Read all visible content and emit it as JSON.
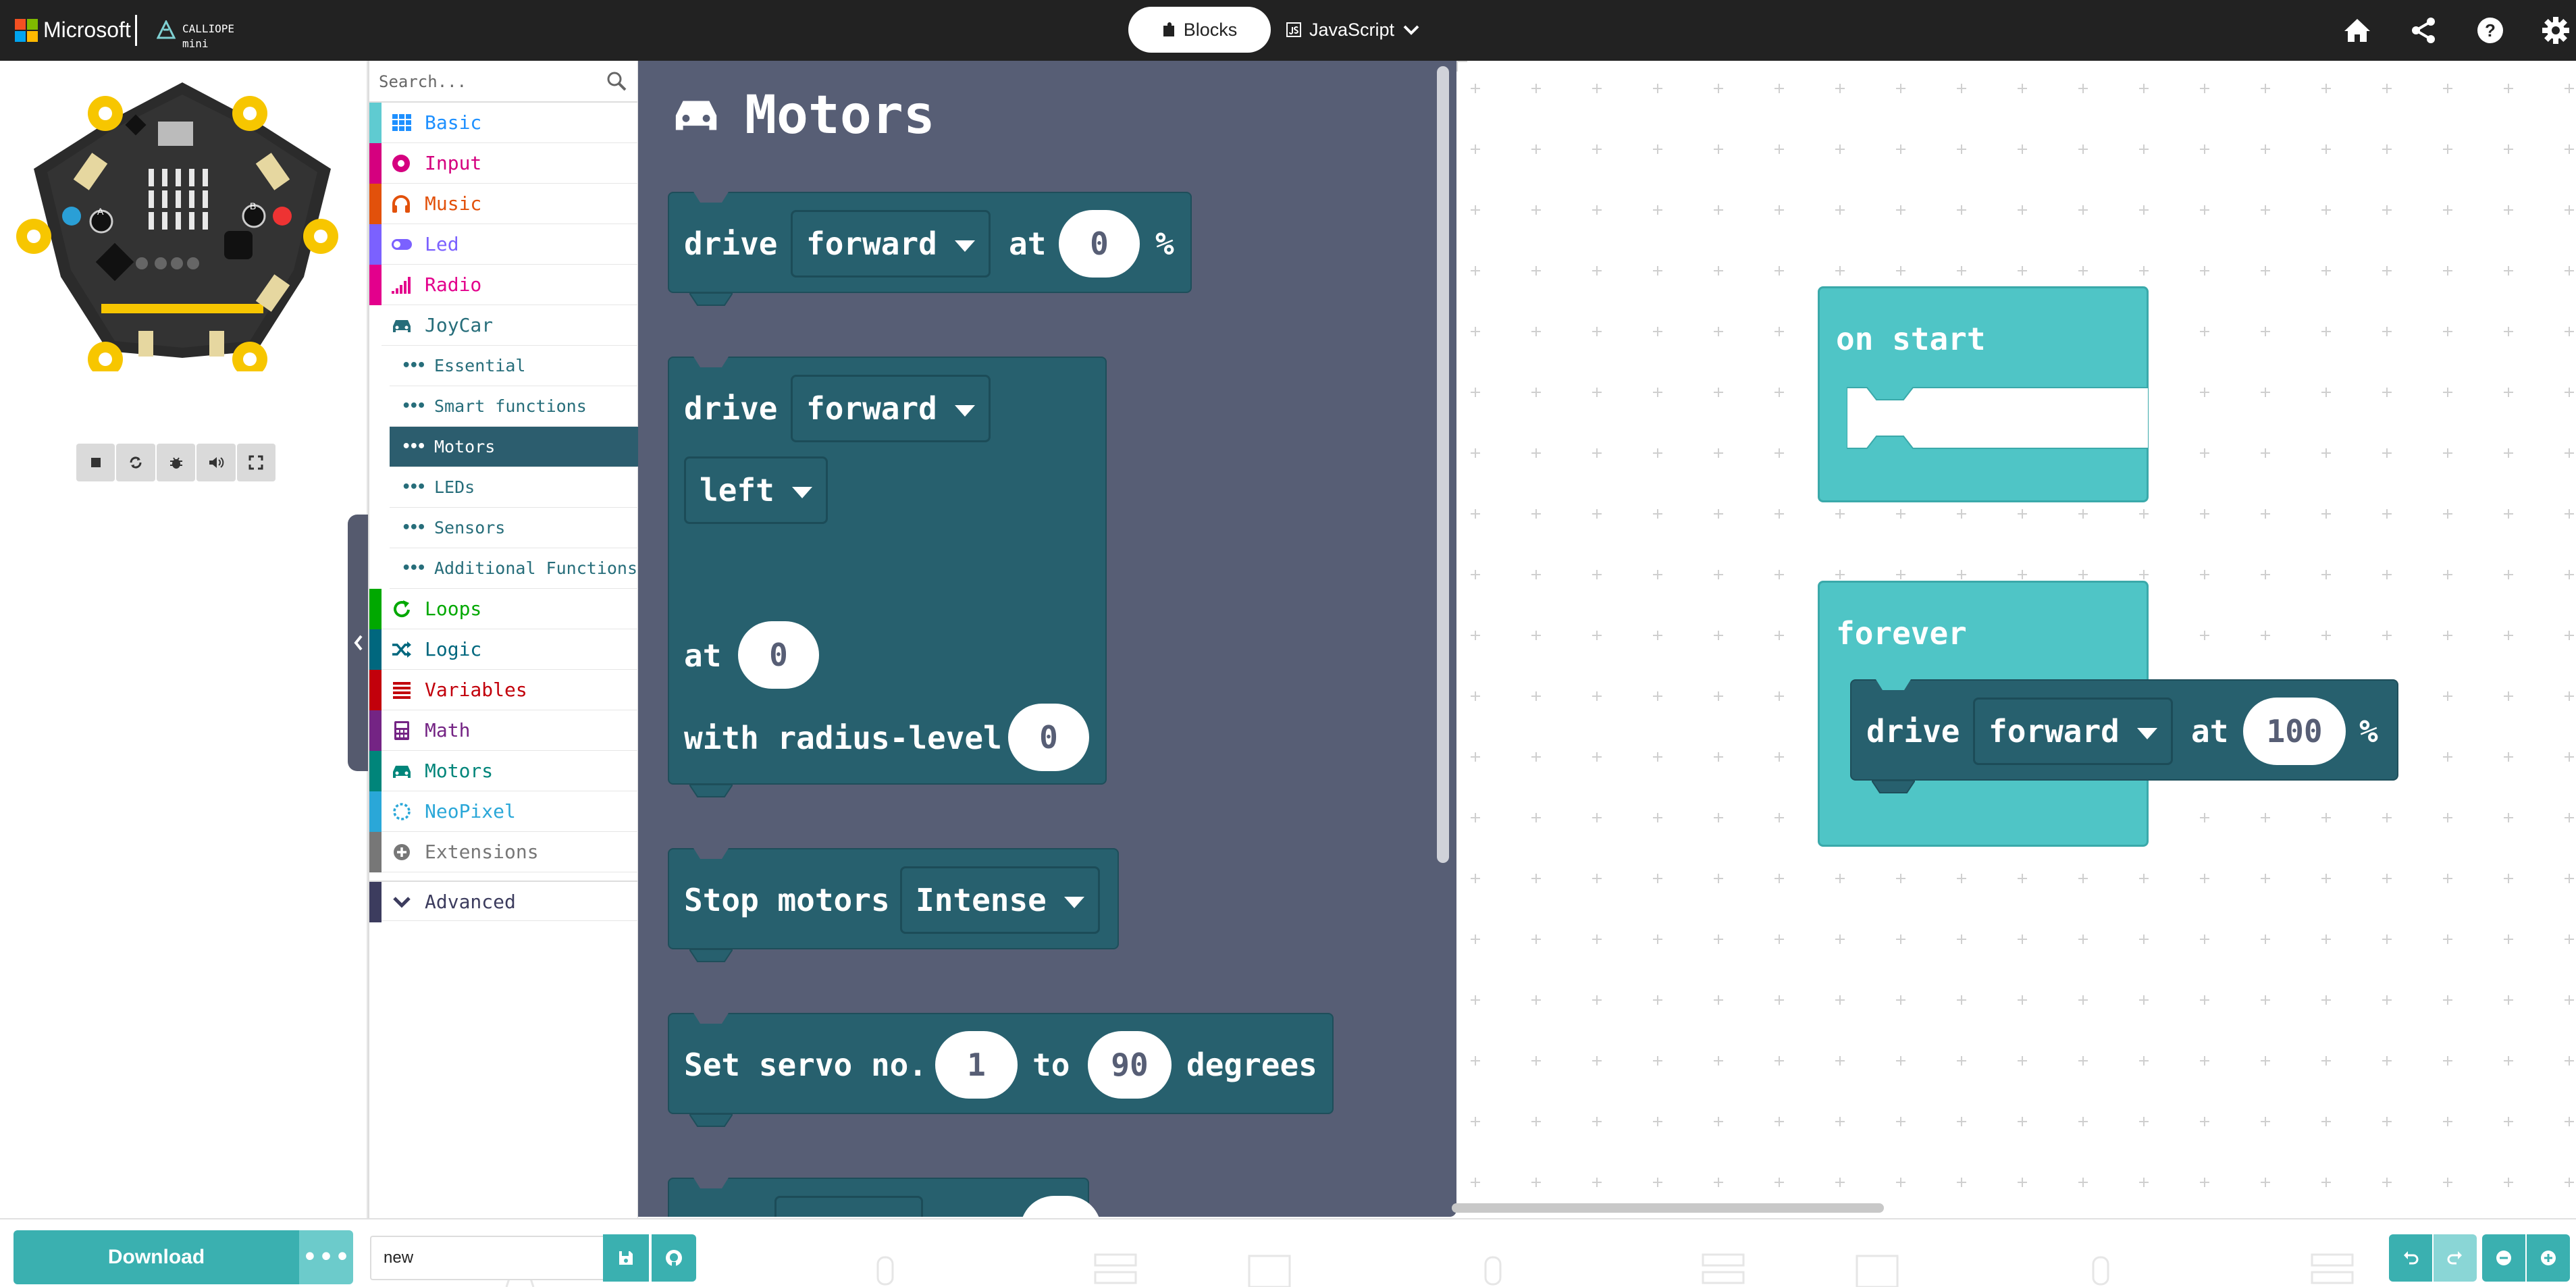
{
  "header": {
    "brand": "Microsoft",
    "product": "CALLIOPE mini",
    "tabs": [
      {
        "label": "Blocks",
        "active": true
      },
      {
        "label": "JavaScript",
        "active": false
      }
    ],
    "icons": [
      "home-icon",
      "share-icon",
      "help-icon",
      "settings-icon"
    ]
  },
  "simulator": {
    "controls": [
      "stop-icon",
      "restart-icon",
      "debug-icon",
      "mute-icon",
      "fullscreen-icon"
    ]
  },
  "toolbox": {
    "search_placeholder": "Search...",
    "categories": [
      {
        "label": "Basic",
        "color": "#5fcbd1",
        "icon": "grid-icon"
      },
      {
        "label": "Input",
        "color": "#d5007f",
        "icon": "circle-dot-icon"
      },
      {
        "label": "Music",
        "color": "#e2510b",
        "icon": "headphones-icon"
      },
      {
        "label": "Led",
        "color": "#7b61ff",
        "icon": "toggle-icon"
      },
      {
        "label": "Radio",
        "color": "#e3008c",
        "icon": "signal-icon"
      },
      {
        "label": "JoyCar",
        "color": "#266d7a",
        "icon": "car-icon"
      },
      {
        "label": "Loops",
        "color": "#00a800",
        "icon": "loop-icon"
      },
      {
        "label": "Logic",
        "color": "#00677e",
        "icon": "shuffle-icon"
      },
      {
        "label": "Variables",
        "color": "#c2000b",
        "icon": "list-icon"
      },
      {
        "label": "Math",
        "color": "#742484",
        "icon": "calculator-icon"
      },
      {
        "label": "Motors",
        "color": "#00857a",
        "icon": "car-icon"
      },
      {
        "label": "NeoPixel",
        "color": "#2aa7d8",
        "icon": "ring-icon"
      },
      {
        "label": "Extensions",
        "color": "#777777",
        "icon": "plus-circle-icon"
      },
      {
        "label": "Advanced",
        "color": "#3c3c5e",
        "icon": "chevron-down-icon"
      }
    ],
    "joycar_subcategories": [
      {
        "label": "Essential",
        "selected": false
      },
      {
        "label": "Smart functions",
        "selected": false
      },
      {
        "label": "Motors",
        "selected": true
      },
      {
        "label": "LEDs",
        "selected": false
      },
      {
        "label": "Sensors",
        "selected": false
      },
      {
        "label": "Additional Functions",
        "selected": false
      }
    ]
  },
  "flyout": {
    "title": "Motors",
    "block1": {
      "drive": "drive",
      "direction": "forward",
      "at": "at",
      "speed": "0",
      "unit": "%"
    },
    "block2": {
      "drive": "drive",
      "direction": "forward",
      "turn": "left",
      "at": "at",
      "speed": "0",
      "with": "with radius-level",
      "radius": "0"
    },
    "block3": {
      "label": "Stop motors",
      "mode": "Intense"
    },
    "block4": {
      "label": "Set servo no.",
      "servo": "1",
      "to": "to",
      "angle": "90",
      "unit": "degrees"
    }
  },
  "workspace": {
    "on_start": "on start",
    "forever": "forever",
    "drive_block": {
      "drive": "drive",
      "direction": "forward",
      "at": "at",
      "speed": "100",
      "unit": "%"
    }
  },
  "footer": {
    "download_label": "Download",
    "more_label": "•••",
    "project_name": "new",
    "icons": [
      "save-icon",
      "github-icon",
      "undo-icon",
      "redo-icon",
      "zoom-out-icon",
      "zoom-in-icon"
    ]
  },
  "colors": {
    "topbar": "#222222",
    "accent": "#3ab0b0",
    "flyout_bg": "#575e75",
    "motor_block": "#27606e",
    "event_block": "#4fc5c6"
  }
}
